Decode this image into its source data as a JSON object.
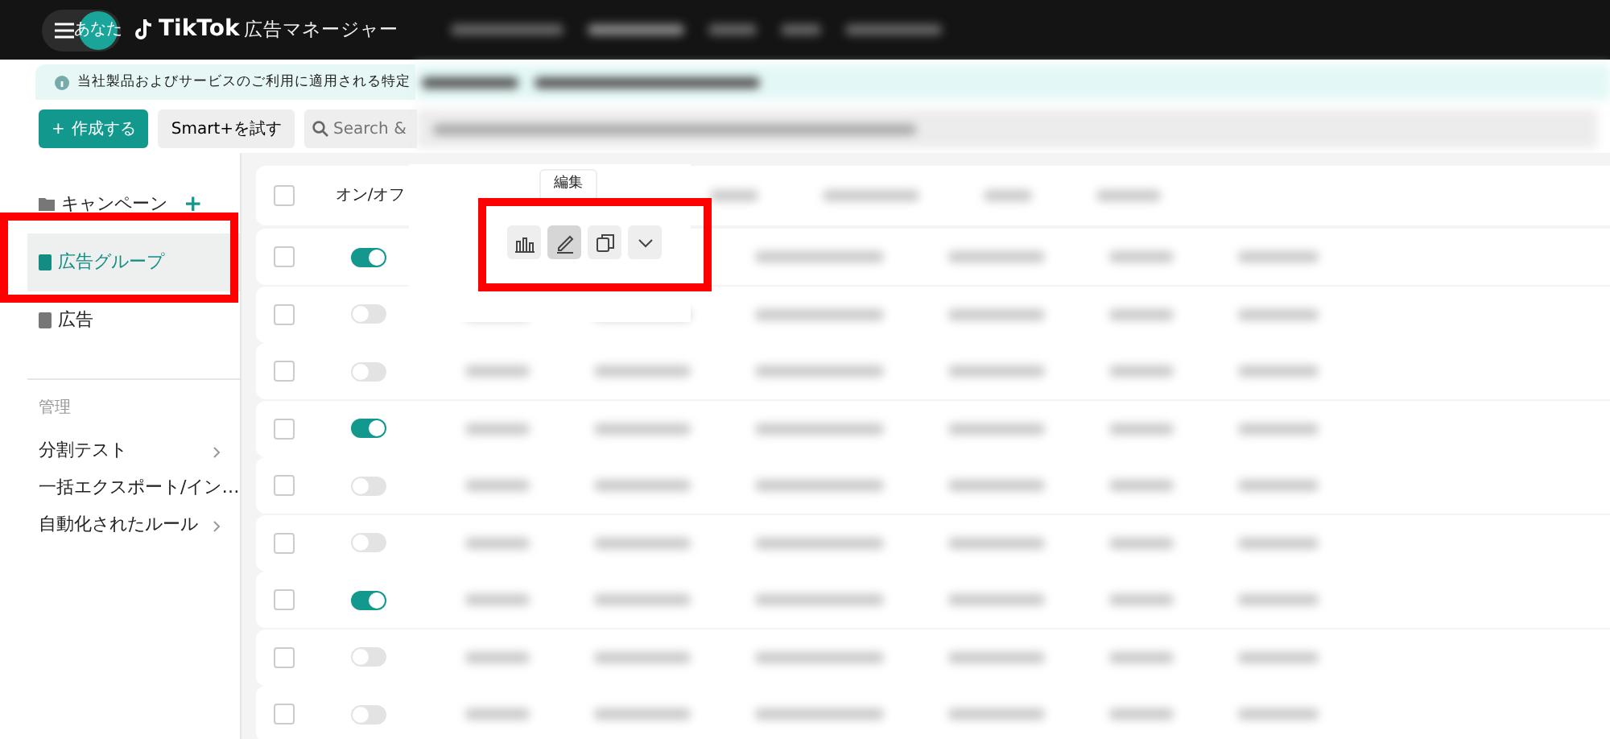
{
  "header": {
    "avatar": "あなた",
    "brand": "TikTok",
    "product": "広告マネージャー"
  },
  "notice": "当社製品およびサービスのご利用に適用される特定",
  "toolbar": {
    "create_icon": "+",
    "create": "作成する",
    "smart": "Smart+を試す",
    "search_placeholder": "Search &"
  },
  "sidebar": {
    "levels": [
      {
        "label": "キャンペーン",
        "kind": "campaign",
        "add": "+",
        "selected": false,
        "highlighted": false
      },
      {
        "label": "広告グループ",
        "kind": "adgroup",
        "selected": true,
        "highlighted": true
      },
      {
        "label": "広告",
        "kind": "ad",
        "selected": false,
        "highlighted": false
      }
    ],
    "section": "管理",
    "items": [
      {
        "label": "分割テスト"
      },
      {
        "label": "一括エクスポート/イン…"
      },
      {
        "label": "自動化されたルール"
      }
    ]
  },
  "table": {
    "select_all_checked": false,
    "column_2": "オン/オフ",
    "rows": [
      {
        "checked": false,
        "on": true
      },
      {
        "checked": false,
        "on": false
      },
      {
        "checked": false,
        "on": false
      },
      {
        "checked": false,
        "on": true
      },
      {
        "checked": false,
        "on": false
      },
      {
        "checked": false,
        "on": false
      },
      {
        "checked": false,
        "on": true
      },
      {
        "checked": false,
        "on": false
      },
      {
        "checked": false,
        "on": false
      }
    ]
  },
  "action_toolbar": {
    "highlighted": true,
    "tooltip": "編集",
    "buttons": [
      {
        "kind": "chart",
        "active": false
      },
      {
        "kind": "edit",
        "active": true
      },
      {
        "kind": "copy",
        "active": false
      },
      {
        "kind": "more",
        "active": false
      }
    ]
  }
}
